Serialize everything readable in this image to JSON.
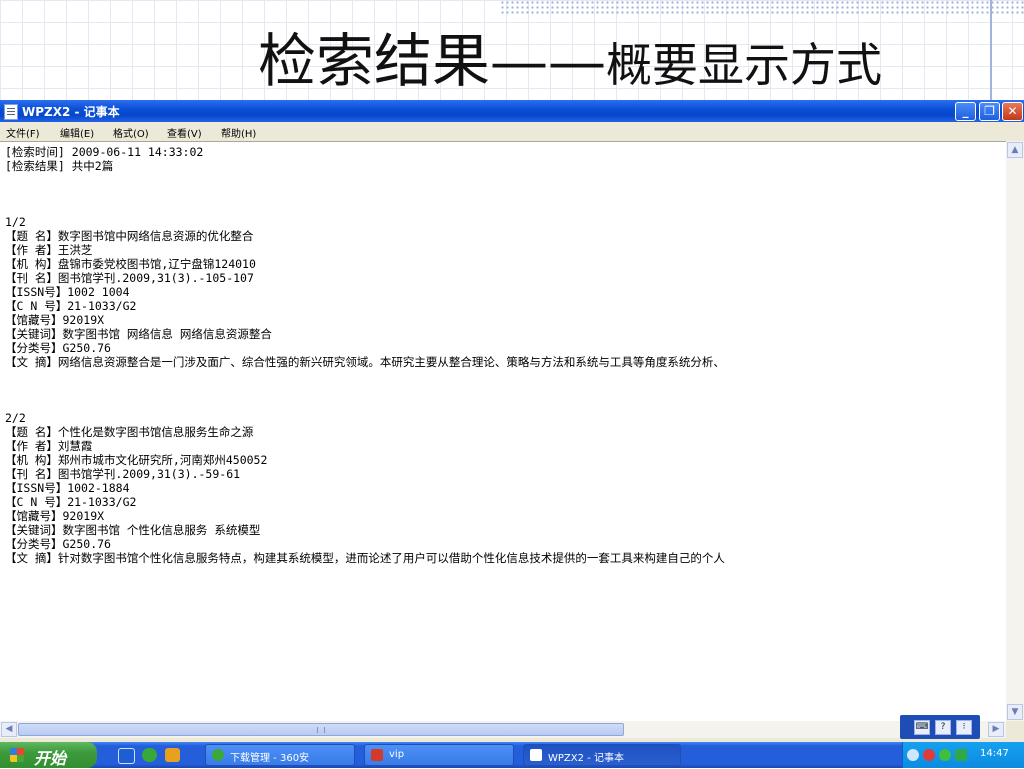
{
  "slide": {
    "title_main": "检索结果",
    "title_dash": "——",
    "title_sub": "概要显示方式"
  },
  "window": {
    "title": "WPZX2 - 记事本",
    "buttons": {
      "minimize": "_",
      "restore": "❐",
      "close": "✕"
    }
  },
  "menu": [
    "文件(F)",
    "编辑(E)",
    "格式(O)",
    "查看(V)",
    "帮助(H)"
  ],
  "lines": [
    "[检索时间] 2009-06-11 14:33:02",
    "[检索结果] 共中2篇",
    "",
    "",
    "",
    "1/2",
    "【题  名】数字图书馆中网络信息资源的优化整合",
    "【作  者】王洪芝",
    "【机  构】盘锦市委党校图书馆,辽宁盘锦124010",
    "【刊  名】图书馆学刊.2009,31(3).-105-107",
    "【ISSN号】1002 1004",
    "【C N 号】21-1033/G2",
    "【馆藏号】92019X",
    "【关键词】数字图书馆 网络信息 网络信息资源整合",
    "【分类号】G250.76",
    "【文  摘】网络信息资源整合是一门涉及面广、综合性强的新兴研究领域。本研究主要从整合理论、策略与方法和系统与工具等角度系统分析、",
    "",
    "",
    "",
    "2/2",
    "【题  名】个性化是数字图书馆信息服务生命之源",
    "【作  者】刘慧霞",
    "【机  构】郑州市城市文化研究所,河南郑州450052",
    "【刊  名】图书馆学刊.2009,31(3).-59-61",
    "【ISSN号】1002-1884",
    "【C N 号】21-1033/G2",
    "【馆藏号】92019X",
    "【关键词】数字图书馆 个性化信息服务 系统模型",
    "【分类号】G250.76",
    "【文  摘】针对数字图书馆个性化信息服务特点，构建其系统模型，进而论述了用户可以借助个性化信息技术提供的一套工具来构建自己的个人"
  ],
  "scroll_arrows": {
    "up": "▲",
    "down": "▼",
    "left": "◀",
    "right": "▶"
  },
  "langbar": {
    "kbd": "⌨",
    "help": "?",
    "opt": "⁝"
  },
  "taskbar": {
    "start_label": "开始",
    "tasks": [
      {
        "label": "下载管理 - 360安",
        "icon_color": "#3aa83a"
      },
      {
        "label": "vip",
        "icon_color": "#d23a2a"
      },
      {
        "label": "WPZX2 - 记事本",
        "icon_color": "#ffffff"
      }
    ],
    "clock": "14:47"
  }
}
